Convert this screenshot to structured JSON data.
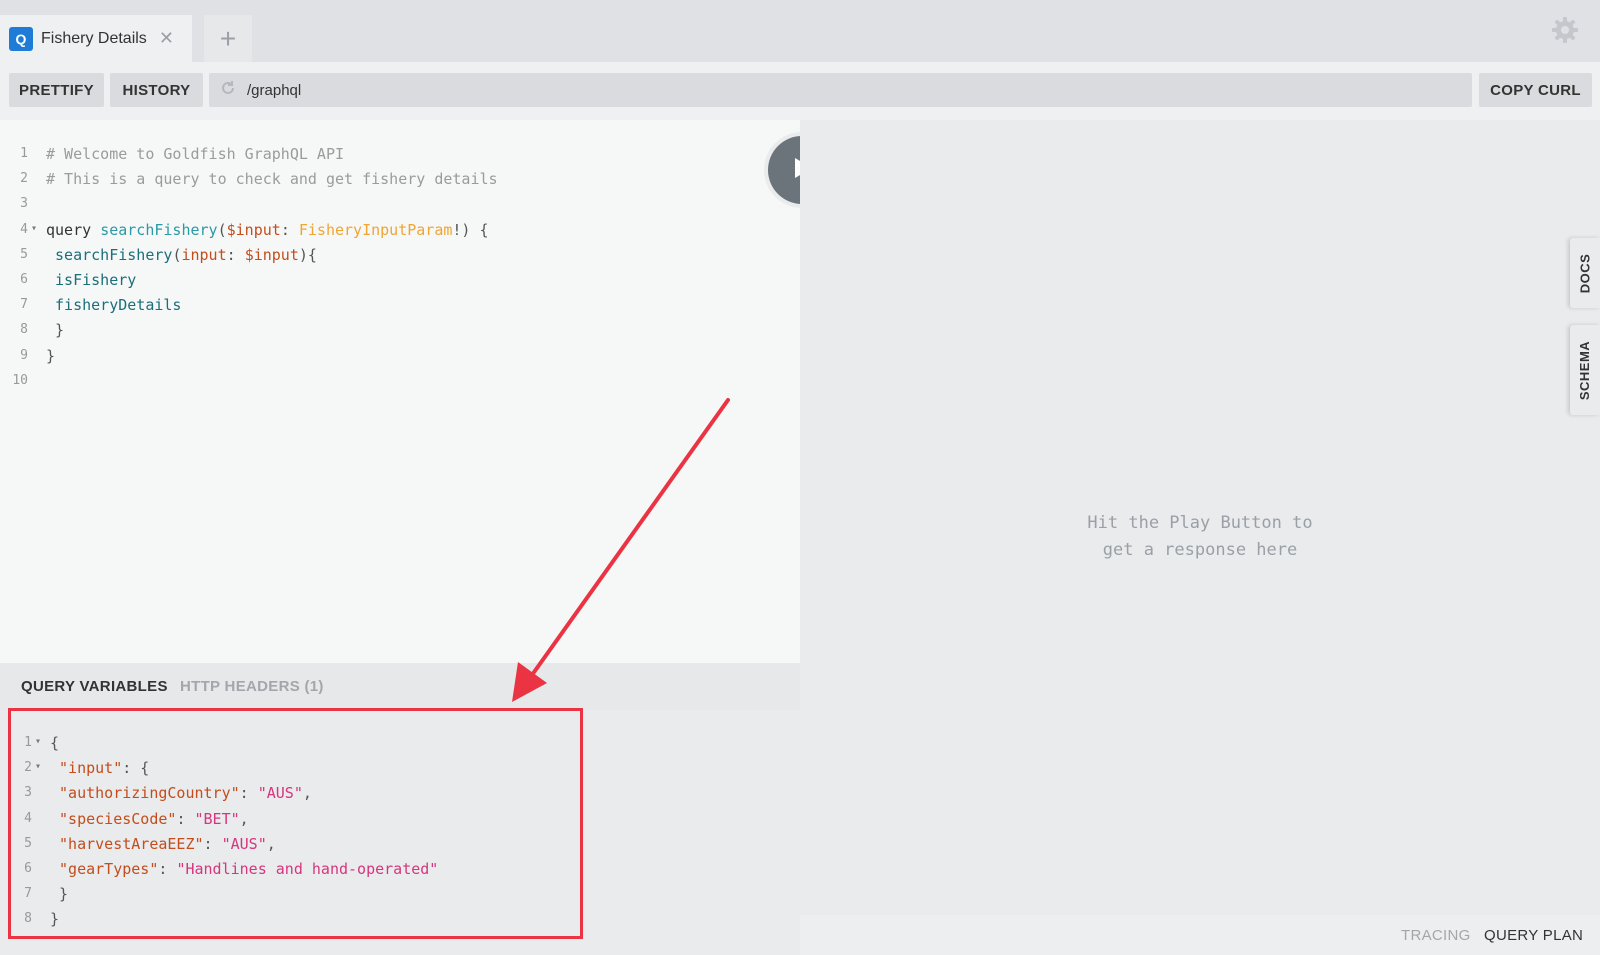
{
  "tabs": [
    {
      "badge": "Q",
      "title": "Fishery Details",
      "close": "✕"
    }
  ],
  "add_tab": "+",
  "toolbar": {
    "prettify": "PRETTIFY",
    "history": "HISTORY",
    "url": "/graphql",
    "copy_curl": "COPY CURL"
  },
  "query_lines": [
    {
      "n": "1",
      "tokens": [
        {
          "c": "comment",
          "t": "# Welcome to Goldfish GraphQL API"
        }
      ]
    },
    {
      "n": "2",
      "tokens": [
        {
          "c": "comment",
          "t": "# This is a query to check and get fishery details"
        }
      ]
    },
    {
      "n": "3",
      "tokens": []
    },
    {
      "n": "4",
      "fold": "▾",
      "tokens": [
        {
          "c": "kw",
          "t": "query "
        },
        {
          "c": "def",
          "t": "searchFishery"
        },
        {
          "c": "punct",
          "t": "("
        },
        {
          "c": "var",
          "t": "$input"
        },
        {
          "c": "punct",
          "t": ": "
        },
        {
          "c": "type",
          "t": "FisheryInputParam"
        },
        {
          "c": "punct",
          "t": "!) {"
        }
      ]
    },
    {
      "n": "5",
      "tokens": [
        {
          "c": "prop",
          "t": " searchFishery"
        },
        {
          "c": "punct",
          "t": "("
        },
        {
          "c": "attr",
          "t": "input"
        },
        {
          "c": "punct",
          "t": ": "
        },
        {
          "c": "var",
          "t": "$input"
        },
        {
          "c": "punct",
          "t": "){"
        }
      ]
    },
    {
      "n": "6",
      "tokens": [
        {
          "c": "prop",
          "t": " isFishery"
        }
      ]
    },
    {
      "n": "7",
      "tokens": [
        {
          "c": "prop",
          "t": " fisheryDetails"
        }
      ]
    },
    {
      "n": "8",
      "tokens": [
        {
          "c": "punct",
          "t": " }"
        }
      ]
    },
    {
      "n": "9",
      "tokens": [
        {
          "c": "punct",
          "t": "}"
        }
      ]
    },
    {
      "n": "10",
      "tokens": []
    }
  ],
  "result_hint": [
    "Hit the Play Button to",
    "get a response here"
  ],
  "side_tabs": {
    "docs": "DOCS",
    "schema": "SCHEMA"
  },
  "vars_tabs": {
    "query_variables": "QUERY VARIABLES",
    "http_headers": "HTTP HEADERS (1)"
  },
  "variable_lines": [
    {
      "n": "1",
      "fold": "▾",
      "tokens": [
        {
          "c": "punct",
          "t": "{"
        }
      ]
    },
    {
      "n": "2",
      "fold": "▾",
      "tokens": [
        {
          "c": "key",
          "t": " \"input\""
        },
        {
          "c": "punct",
          "t": ": {"
        }
      ]
    },
    {
      "n": "3",
      "tokens": [
        {
          "c": "key",
          "t": " \"authorizingCountry\""
        },
        {
          "c": "punct",
          "t": ": "
        },
        {
          "c": "str",
          "t": "\"AUS\""
        },
        {
          "c": "punct",
          "t": ","
        }
      ]
    },
    {
      "n": "4",
      "tokens": [
        {
          "c": "key",
          "t": " \"speciesCode\""
        },
        {
          "c": "punct",
          "t": ": "
        },
        {
          "c": "str",
          "t": "\"BET\""
        },
        {
          "c": "punct",
          "t": ","
        }
      ]
    },
    {
      "n": "5",
      "tokens": [
        {
          "c": "key",
          "t": " \"harvestAreaEEZ\""
        },
        {
          "c": "punct",
          "t": ": "
        },
        {
          "c": "str",
          "t": "\"AUS\""
        },
        {
          "c": "punct",
          "t": ","
        }
      ]
    },
    {
      "n": "6",
      "tokens": [
        {
          "c": "key",
          "t": " \"gearTypes\""
        },
        {
          "c": "punct",
          "t": ": "
        },
        {
          "c": "str",
          "t": "\"Handlines and hand-operated\""
        }
      ]
    },
    {
      "n": "7",
      "tokens": [
        {
          "c": "punct",
          "t": " }"
        }
      ]
    },
    {
      "n": "8",
      "tokens": [
        {
          "c": "punct",
          "t": "}"
        }
      ]
    }
  ],
  "footer": {
    "tracing": "TRACING",
    "query_plan": "QUERY PLAN"
  },
  "colors": {
    "annotation": "#ea3343",
    "tab_badge": "#1e7bd6",
    "play_button": "#6b737b"
  },
  "icons": {
    "settings": "gear-icon",
    "play": "play-icon",
    "reload": "reload-icon",
    "close": "close-icon",
    "add": "plus-icon"
  }
}
